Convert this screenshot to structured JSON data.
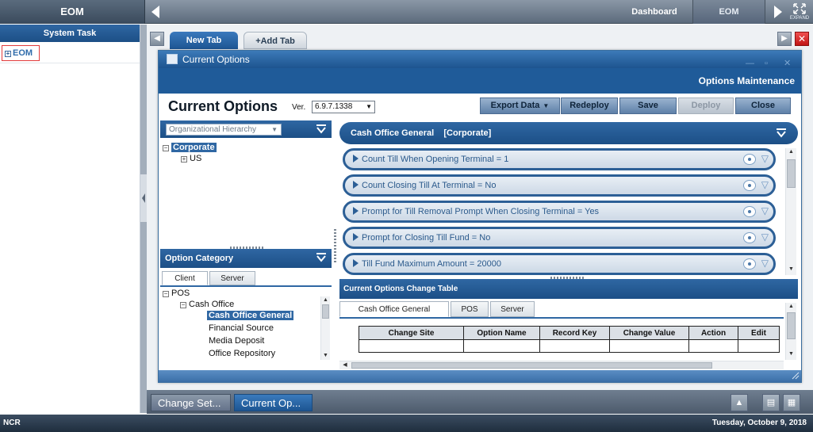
{
  "app": {
    "brand": "EOM",
    "dashboard_link": "Dashboard",
    "eom_link": "EOM",
    "expand_label": "EXPAND"
  },
  "left_panel": {
    "title": "System Task",
    "item": "EOM"
  },
  "tabs": {
    "new_tab": "New Tab",
    "add_tab": "+Add Tab"
  },
  "window": {
    "title": "Current Options",
    "subheader": "Options Maintenance",
    "page_title": "Current Options",
    "version_label": "Ver.",
    "version_value": "6.9.7.1338",
    "buttons": {
      "export": "Export Data",
      "redeploy": "Redeploy",
      "save": "Save",
      "deploy": "Deploy",
      "close": "Close"
    }
  },
  "org_panel": {
    "select_placeholder": "Organizational Hierarchy",
    "tree": [
      {
        "label": "Corporate",
        "selected": true
      },
      {
        "label": "US",
        "selected": false
      }
    ]
  },
  "option_category": {
    "title": "Option Category",
    "tabs": [
      "Client",
      "Server"
    ],
    "active_tab": "Client",
    "tree": {
      "root": "POS",
      "group": "Cash Office",
      "items": [
        "Cash Office General",
        "Financial Source",
        "Media Deposit",
        "Office Repository"
      ],
      "selected": "Cash Office General"
    }
  },
  "options": {
    "header": "Cash Office General    [Corporate]",
    "rows": [
      "Count Till When Opening Terminal =  1",
      "Count Closing Till At Terminal =  No",
      "Prompt for Till Removal Prompt When Closing Terminal =  Yes",
      "Prompt for Closing Till Fund =  No",
      "Till Fund Maximum Amount =  20000"
    ]
  },
  "change_table": {
    "title": "Current Options Change Table",
    "tabs": [
      "Cash Office General",
      "POS",
      "Server"
    ],
    "active_tab": "Cash Office General",
    "columns": [
      "Change Site",
      "Option Name",
      "Record Key",
      "Change Value",
      "Action",
      "Edit"
    ]
  },
  "taskbar": {
    "change_set": "Change Set...",
    "current_op": "Current Op..."
  },
  "status": {
    "left": "NCR",
    "right": "Tuesday, October 9, 2018"
  }
}
